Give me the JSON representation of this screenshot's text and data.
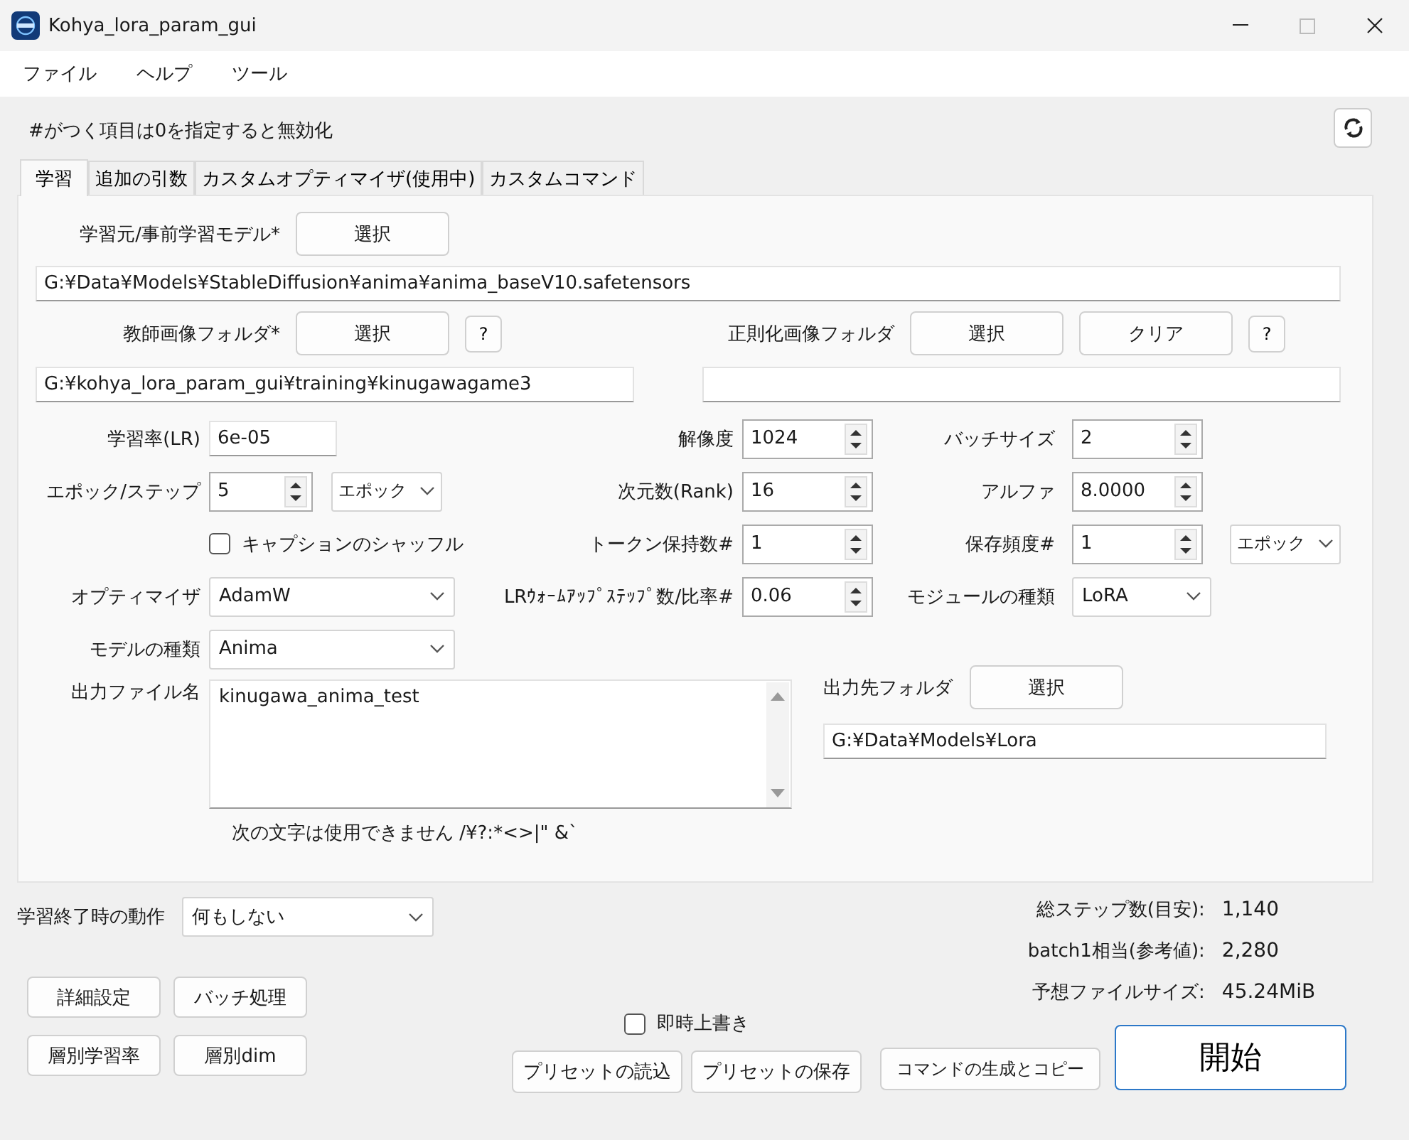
{
  "window": {
    "title": "Kohya_lora_param_gui",
    "maximizable": false
  },
  "menu": [
    {
      "label": "ファイル"
    },
    {
      "label": "ヘルプ"
    },
    {
      "label": "ツール"
    }
  ],
  "note": "#がつく項目は0を指定すると無効化",
  "tabs": [
    {
      "label": "学習",
      "selected": true
    },
    {
      "label": "追加の引数",
      "selected": false
    },
    {
      "label": "カスタムオプティマイザ(使用中)",
      "selected": false
    },
    {
      "label": "カスタムコマンド",
      "selected": false
    }
  ],
  "base_model": {
    "label": "学習元/事前学習モデル*",
    "button": "選択",
    "path": "G:¥Data¥Models¥StableDiffusion¥anima¥anima_baseV10.safetensors"
  },
  "train_folder": {
    "label": "教師画像フォルダ*",
    "button": "選択",
    "help": "?",
    "path": "G:¥kohya_lora_param_gui¥training¥kinugawagame3"
  },
  "reg_folder": {
    "label": "正則化画像フォルダ",
    "button": "選択",
    "clear": "クリア",
    "help": "?"
  },
  "param_columns": [
    {
      "fields": [
        {
          "kind": "text",
          "label": "学習率(LR)",
          "value": "6e-05"
        },
        {
          "kind": "spin",
          "label": "エポック/ステップ",
          "value": "5",
          "unit": "エポック"
        },
        {
          "kind": "checkbox",
          "label": "キャプションのシャッフル",
          "checked": false
        },
        {
          "kind": "select",
          "label": "オプティマイザ",
          "value": "AdamW"
        },
        {
          "kind": "select",
          "label": "モデルの種類",
          "value": "Anima"
        }
      ]
    },
    {
      "fields": [
        {
          "kind": "spin",
          "label": "解像度",
          "value": "1024"
        },
        {
          "kind": "spin",
          "label": "次元数(Rank)",
          "value": "16"
        },
        {
          "kind": "spin",
          "label": "トークン保持数#",
          "value": "1"
        },
        {
          "kind": "spin",
          "label": "LRｳｫｰﾑｱｯﾌﾟｽﾃｯﾌﾟ数/比率#",
          "value": "0.06"
        }
      ]
    },
    {
      "fields": [
        {
          "kind": "spin",
          "label": "バッチサイズ",
          "value": "2"
        },
        {
          "kind": "spin",
          "label": "アルファ",
          "value": "8.0000"
        },
        {
          "kind": "spin",
          "label": "保存頻度#",
          "value": "1",
          "unit": "エポック"
        },
        {
          "kind": "select",
          "label": "モジュールの種類",
          "value": "LoRA"
        }
      ]
    }
  ],
  "output_file": {
    "label": "出力ファイル名",
    "value": "kinugawa_anima_test",
    "hint": "次の文字は使用できません /¥?:*<>|\" &`"
  },
  "output_folder": {
    "label": "出力先フォルダ",
    "button": "選択",
    "path": "G:¥Data¥Models¥Lora"
  },
  "end_action": {
    "label": "学習終了時の動作",
    "value": "何もしない"
  },
  "tool_buttons": [
    "詳細設定",
    "バッチ処理",
    "層別学習率",
    "層別dim"
  ],
  "overwrite": {
    "label": "即時上書き",
    "checked": false
  },
  "preset_buttons": [
    "プリセットの読込",
    "プリセットの保存"
  ],
  "stats": [
    {
      "label": "総ステップ数(目安):",
      "value": "1,140"
    },
    {
      "label": "batch1相当(参考値):",
      "value": "2,280"
    },
    {
      "label": "予想ファイルサイズ:",
      "value": "45.24MiB"
    }
  ],
  "command_button": "コマンドの生成とコピー",
  "start_button": "開始"
}
